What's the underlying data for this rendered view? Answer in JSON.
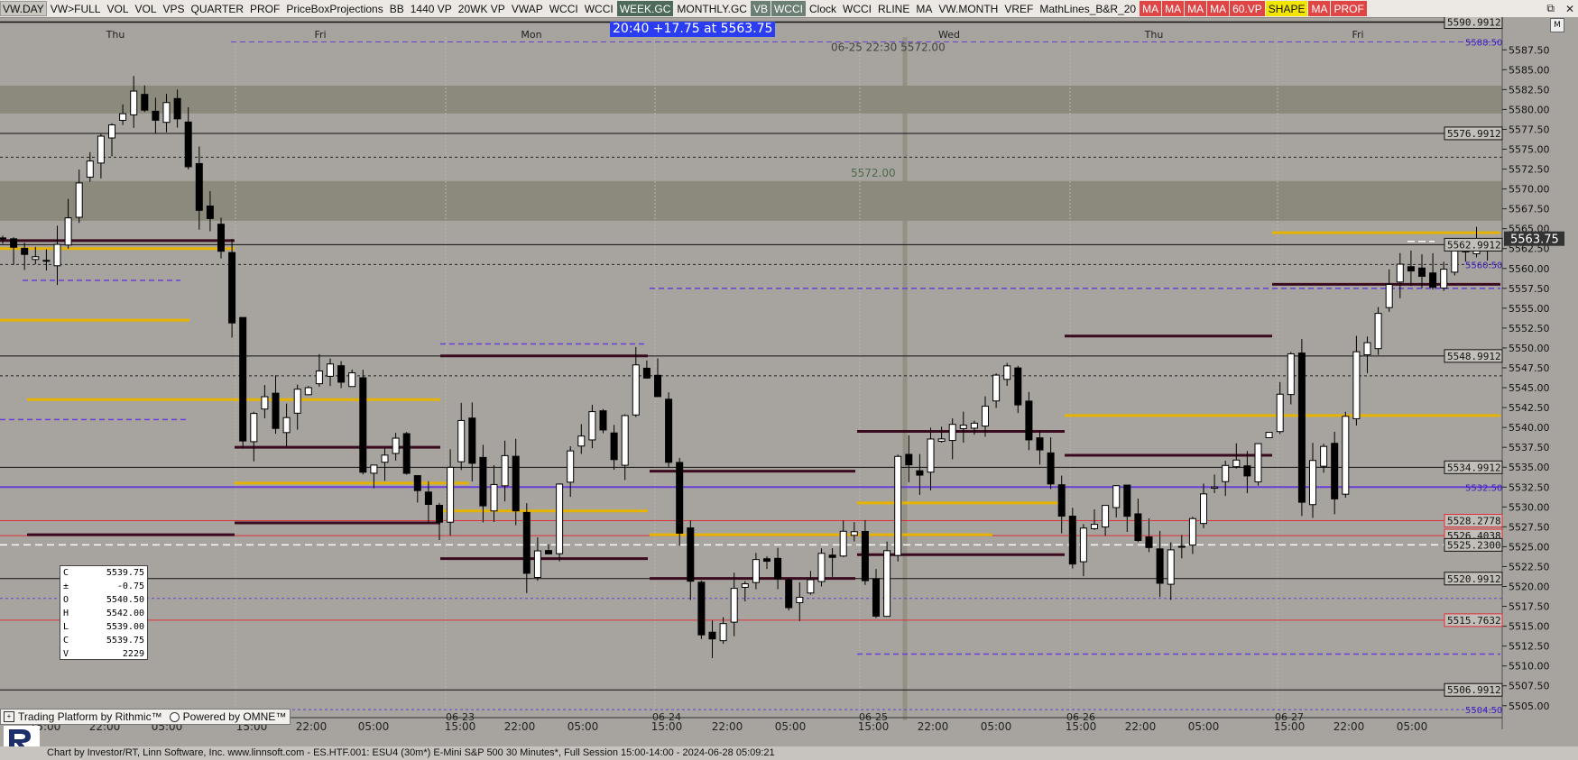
{
  "toolbar": [
    {
      "label": "VW.DAY",
      "style": "active"
    },
    {
      "label": "VW>FULL",
      "style": ""
    },
    {
      "label": "VOL",
      "style": ""
    },
    {
      "label": "VOL",
      "style": ""
    },
    {
      "label": "VPS",
      "style": ""
    },
    {
      "label": "QUARTER",
      "style": ""
    },
    {
      "label": "PROF",
      "style": ""
    },
    {
      "label": "PriceBoxProjections",
      "style": ""
    },
    {
      "label": "BB",
      "style": ""
    },
    {
      "label": "1440 VP",
      "style": ""
    },
    {
      "label": "20WK VP",
      "style": ""
    },
    {
      "label": "VWAP",
      "style": ""
    },
    {
      "label": "WCCI",
      "style": ""
    },
    {
      "label": "WCCI",
      "style": ""
    },
    {
      "label": "WEEK.GC",
      "style": "darker"
    },
    {
      "label": "MONTHLY.GC",
      "style": ""
    },
    {
      "label": "VB",
      "style": "dark"
    },
    {
      "label": "WCCI",
      "style": "dark"
    },
    {
      "label": "Clock",
      "style": ""
    },
    {
      "label": "WCCI",
      "style": ""
    },
    {
      "label": "RLINE",
      "style": ""
    },
    {
      "label": "MA",
      "style": ""
    },
    {
      "label": "VW.MONTH",
      "style": ""
    },
    {
      "label": "VREF",
      "style": ""
    },
    {
      "label": "MathLines_B&R_20",
      "style": ""
    },
    {
      "label": "MA",
      "style": "red"
    },
    {
      "label": "MA",
      "style": "red"
    },
    {
      "label": "MA",
      "style": "red"
    },
    {
      "label": "MA",
      "style": "red"
    },
    {
      "label": "60.VP",
      "style": "red"
    },
    {
      "label": "SHAPE",
      "style": "yellow"
    },
    {
      "label": "MA",
      "style": "red"
    },
    {
      "label": "PROF",
      "style": "red"
    }
  ],
  "window_controls": {
    "restore": "⧉",
    "close": "✕"
  },
  "banner": "20:40  +17.75 at 5563.75",
  "m_button": "M",
  "ohlc_box": [
    {
      "k": "C",
      "v": "5539.75"
    },
    {
      "k": "±",
      "v": "-0.75"
    },
    {
      "k": "O",
      "v": "5540.50"
    },
    {
      "k": "H",
      "v": "5542.00"
    },
    {
      "k": "L",
      "v": "5539.00"
    },
    {
      "k": "C",
      "v": "5539.75"
    },
    {
      "k": "V",
      "v": "2229"
    }
  ],
  "footer": {
    "platform": "Trading Platform by Rithmic™",
    "powered": "Powered by OMNE™"
  },
  "bottom_text": "Chart by Investor/RT, Linn Software, Inc. www.linnsoft.com - ES.HTF.001: ESU4 (30m*) E-Mini S&P 500 30 Minutes*, Full Session 15:00-14:00 - 2024-06-28 05:09:21",
  "colors": {
    "background": "#a7a39e",
    "zone": "#8b8a7c",
    "gold": "#e6b400",
    "purple": "#6a3fd6",
    "maroon": "#3a0a1e",
    "red": "#e0303a",
    "banner": "#2a3df2"
  },
  "chart_data": {
    "type": "candlestick",
    "symbol": "ESU4",
    "interval": "30 Minutes",
    "ylim": [
      5503.5,
      5591.5
    ],
    "y_ticks": [
      5505,
      5507.5,
      5510,
      5512.5,
      5515,
      5517.5,
      5520,
      5522.5,
      5525,
      5527.5,
      5530,
      5532.5,
      5535,
      5537.5,
      5540,
      5542.5,
      5545,
      5547.5,
      5550,
      5552.5,
      5555,
      5557.5,
      5560,
      5562.5,
      5565,
      5567.5,
      5570,
      5572.5,
      5575,
      5577.5,
      5580,
      5582.5,
      5585,
      5587.5
    ],
    "x_ticks_top": [
      "Thu",
      "Fri",
      "Mon",
      "Wed",
      "Thu",
      "Fri"
    ],
    "x_ticks_bottom": [
      "15:00",
      "22:00",
      "05:00",
      "15:00",
      "22:00",
      "05:00",
      "15:00 06-23",
      "22:00",
      "05:00",
      "15:00 06-24",
      "22:00",
      "05:00",
      "15:00 06-25",
      "22:00",
      "05:00",
      "15:00 06-26",
      "22:00",
      "05:00",
      "15:00 06-27",
      "22:00",
      "05:00"
    ],
    "price_labels": [
      {
        "text": "5590.9912",
        "value": 5590.9912,
        "style": "box"
      },
      {
        "text": "5588.50",
        "value": 5588.5,
        "style": "purple"
      },
      {
        "text": "5576.9912",
        "value": 5576.9912,
        "style": "box"
      },
      {
        "text": "5562.9912",
        "value": 5562.9912,
        "style": "box"
      },
      {
        "text": "5560.50",
        "value": 5560.5,
        "style": "purple"
      },
      {
        "text": "5548.9912",
        "value": 5548.9912,
        "style": "box"
      },
      {
        "text": "5534.9912",
        "value": 5534.9912,
        "style": "box"
      },
      {
        "text": "5532.50",
        "value": 5532.5,
        "style": "purple"
      },
      {
        "text": "5528.2778",
        "value": 5528.2778,
        "style": "red"
      },
      {
        "text": "5526.4038",
        "value": 5526.4038,
        "style": "red"
      },
      {
        "text": "5525.2300",
        "value": 5525.23,
        "style": "box"
      },
      {
        "text": "5520.9912",
        "value": 5520.9912,
        "style": "box"
      },
      {
        "text": "5515.7632",
        "value": 5515.7632,
        "style": "red"
      },
      {
        "text": "5506.9912",
        "value": 5506.9912,
        "style": "box"
      },
      {
        "text": "5504.50",
        "value": 5504.5,
        "style": "purple"
      }
    ],
    "current_price": {
      "text": "5563.75",
      "value": 5563.75
    },
    "annotations": [
      {
        "text": "06-25 22:30 5572.00",
        "value": 5588.5
      },
      {
        "text": "5572.00",
        "value": 5572.0
      }
    ],
    "zones": [
      [
        5579.5,
        5583
      ],
      [
        5566,
        5571
      ]
    ],
    "close_path": [
      [
        0.5,
        5563.5
      ],
      [
        2,
        5561.5
      ],
      [
        4,
        5560.5
      ],
      [
        6,
        5567.5
      ],
      [
        8,
        5574.5
      ],
      [
        10,
        5578.5
      ],
      [
        12,
        5582
      ],
      [
        14,
        5580
      ],
      [
        16,
        5579
      ],
      [
        18,
        5568
      ],
      [
        20,
        5562
      ],
      [
        21,
        5554
      ],
      [
        22,
        5539
      ],
      [
        24,
        5544
      ],
      [
        25,
        5541
      ],
      [
        28,
        5546
      ],
      [
        30,
        5548
      ],
      [
        32,
        5546
      ],
      [
        33,
        5534
      ],
      [
        36,
        5538
      ],
      [
        38,
        5533
      ],
      [
        40,
        5528
      ],
      [
        42,
        5541
      ],
      [
        44,
        5530
      ],
      [
        46,
        5536
      ],
      [
        48,
        5523
      ],
      [
        50,
        5525
      ],
      [
        52,
        5538
      ],
      [
        54,
        5541
      ],
      [
        56,
        5536
      ],
      [
        58,
        5548
      ],
      [
        60,
        5545
      ],
      [
        62,
        5526
      ],
      [
        64,
        5513
      ],
      [
        66,
        5516
      ],
      [
        68,
        5521
      ],
      [
        70,
        5523
      ],
      [
        72,
        5517
      ],
      [
        74,
        5521
      ],
      [
        76,
        5525
      ],
      [
        78,
        5527
      ],
      [
        80,
        5516
      ],
      [
        82,
        5536
      ],
      [
        84,
        5535
      ],
      [
        86,
        5540
      ],
      [
        88,
        5540
      ],
      [
        90,
        5544
      ],
      [
        92,
        5549
      ],
      [
        94,
        5539
      ],
      [
        96,
        5533
      ],
      [
        98,
        5524
      ],
      [
        100,
        5529
      ],
      [
        102,
        5532
      ],
      [
        104,
        5526
      ],
      [
        106,
        5521
      ],
      [
        108,
        5526
      ],
      [
        110,
        5532
      ],
      [
        112,
        5536
      ],
      [
        114,
        5535
      ],
      [
        116,
        5540
      ],
      [
        118,
        5550
      ],
      [
        119,
        5532
      ],
      [
        121,
        5537
      ],
      [
        122,
        5531
      ],
      [
        124,
        5549
      ],
      [
        126,
        5553
      ],
      [
        128,
        5561
      ],
      [
        130,
        5558
      ],
      [
        132,
        5560
      ],
      [
        133,
        5563
      ],
      [
        135,
        5564
      ],
      [
        136,
        5563.75
      ]
    ]
  }
}
